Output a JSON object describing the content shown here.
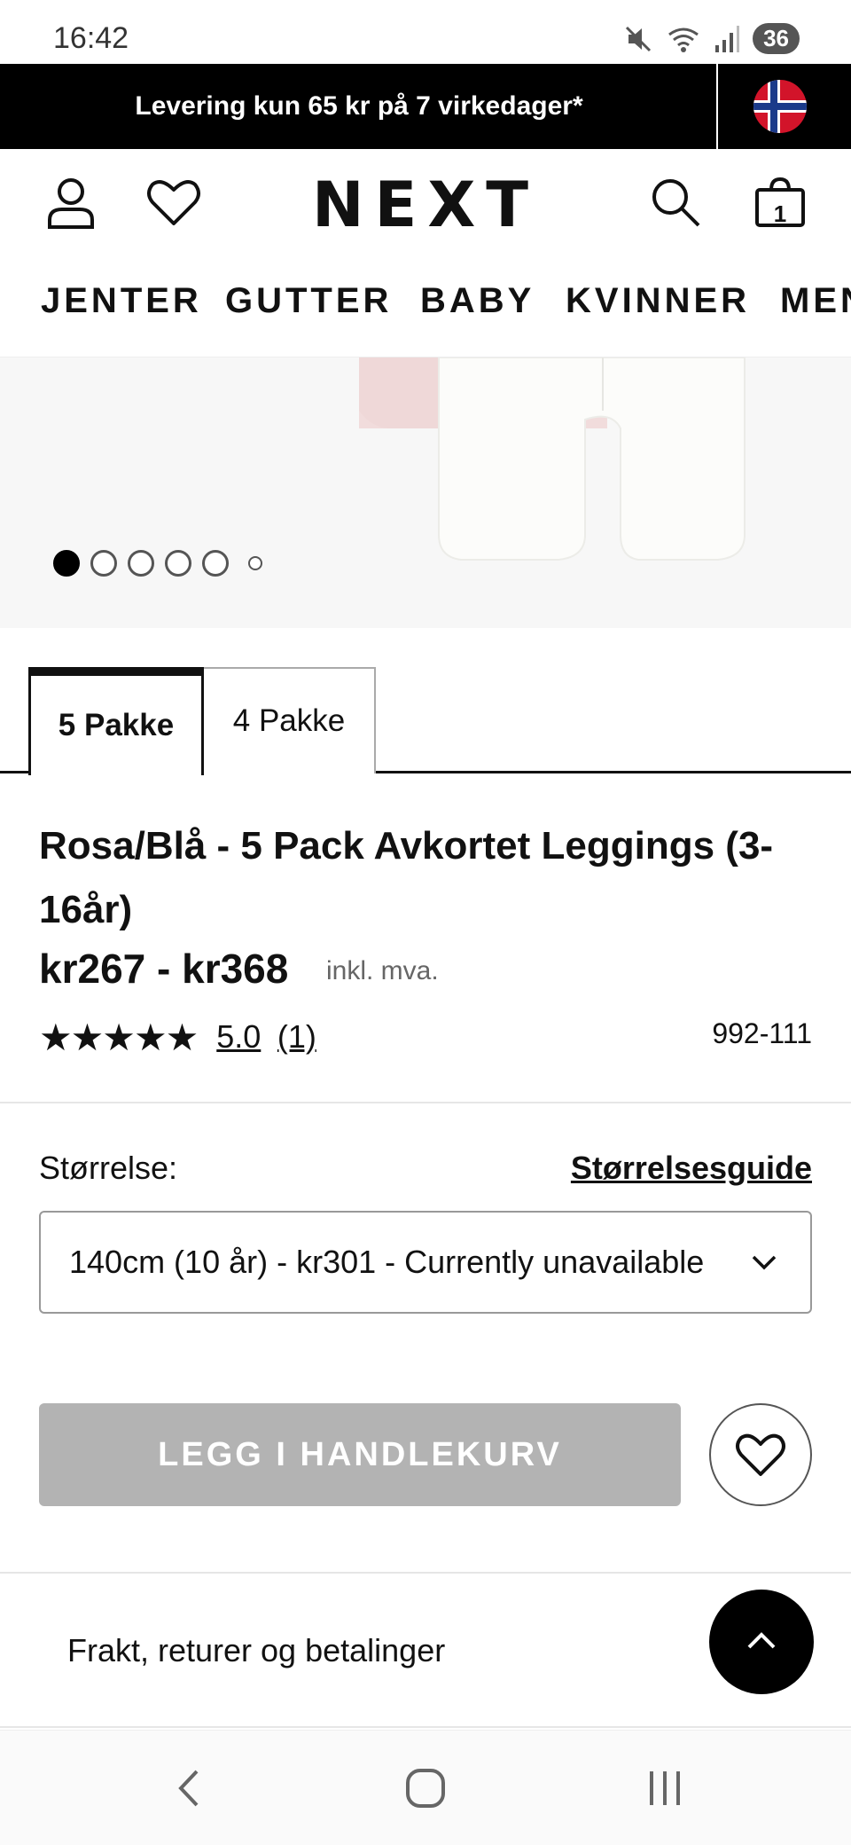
{
  "status_bar": {
    "time": "16:42",
    "battery": "36"
  },
  "promo": {
    "text": "Levering kun 65 kr på 7 virkedager*"
  },
  "header": {
    "logo": "NEXT",
    "bag_count": "1"
  },
  "nav": {
    "items": [
      "JENTER",
      "GUTTER",
      "BABY",
      "KVINNER",
      "MEN"
    ]
  },
  "gallery": {
    "total_dots": 6,
    "active_index": 0
  },
  "tabs": [
    {
      "label": "5 Pakke",
      "active": true
    },
    {
      "label": "4 Pakke",
      "active": false
    }
  ],
  "product": {
    "title": "Rosa/Blå - 5 Pack Avkortet Leggings (3-16år)",
    "price": "kr267 - kr368",
    "vat_note": "inkl. mva.",
    "rating_value": "5.0",
    "rating_count": "(1)",
    "stars": 5,
    "sku": "992-111"
  },
  "size": {
    "label": "Størrelse:",
    "guide_link": "Størrelsesguide",
    "selected": "140cm (10 år) - kr301 - Currently unavailable"
  },
  "actions": {
    "add_to_bag": "LEGG I HANDLEKURV"
  },
  "accordion": {
    "label": "Frakt, returer og betalinger"
  },
  "colors": {
    "disabled_button": "#b3b3b3",
    "black": "#000000"
  }
}
